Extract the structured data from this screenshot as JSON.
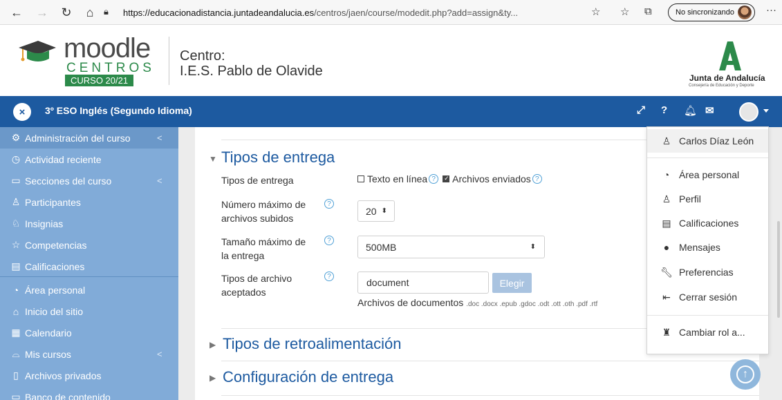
{
  "browser": {
    "url_host": "https://educacionadistancia.juntadeandalucia.es",
    "url_path": "/centros/jaen/course/modedit.php?add=assign&ty...",
    "sync_label": "No sincronizando"
  },
  "header": {
    "logo_word": "moodle",
    "logo_sub": "CENTROS",
    "logo_badge": "CURSO 20/21",
    "centro_label": "Centro:",
    "centro_name": "I.E.S. Pablo de Olavide",
    "junta_name": "Junta de Andalucía",
    "junta_sub": "Consejería de Educación y Deporte"
  },
  "navbar": {
    "course_title": "3º ESO Inglés (Segundo Idioma)"
  },
  "sidebar": {
    "items": [
      {
        "label": "Administración del curso",
        "chevron": "<"
      },
      {
        "label": "Actividad reciente"
      },
      {
        "label": "Secciones del curso",
        "chevron": "<"
      },
      {
        "label": "Participantes"
      },
      {
        "label": "Insignias"
      },
      {
        "label": "Competencias"
      },
      {
        "label": "Calificaciones"
      },
      {
        "label": "Área personal"
      },
      {
        "label": "Inicio del sitio"
      },
      {
        "label": "Calendario"
      },
      {
        "label": "Mis cursos",
        "chevron": "<"
      },
      {
        "label": "Archivos privados"
      },
      {
        "label": "Banco de contenido"
      }
    ]
  },
  "form": {
    "section1_title": "Tipos de entrega",
    "tipos_label": "Tipos de entrega",
    "opt_texto": "Texto en línea",
    "opt_archivos": "Archivos enviados",
    "max_files_label_1": "Número máximo de",
    "max_files_label_2": "archivos subidos",
    "max_files_value": "20",
    "max_size_label_1": "Tamaño máximo de",
    "max_size_label_2": "la entrega",
    "max_size_value": "500MB",
    "accepted_label_1": "Tipos de archivo",
    "accepted_label_2": "aceptados",
    "accepted_value": "document",
    "elegir_button": "Elegir",
    "file_types_name": "Archivos de documentos",
    "file_types_ext": ".doc .docx .epub .gdoc .odt .ott .oth .pdf .rtf",
    "section2_title": "Tipos de retroalimentación",
    "section3_title": "Configuración de entrega"
  },
  "user_menu": {
    "user_name": "Carlos Díaz León",
    "items": [
      {
        "label": "Área personal"
      },
      {
        "label": "Perfil"
      },
      {
        "label": "Calificaciones"
      },
      {
        "label": "Mensajes"
      },
      {
        "label": "Preferencias"
      },
      {
        "label": "Cerrar sesión"
      },
      {
        "label": "Cambiar rol a..."
      }
    ]
  },
  "colors": {
    "navbar": "#1d5aa0",
    "sidebar": "#81abd8",
    "brand_green": "#2c8a4a"
  }
}
